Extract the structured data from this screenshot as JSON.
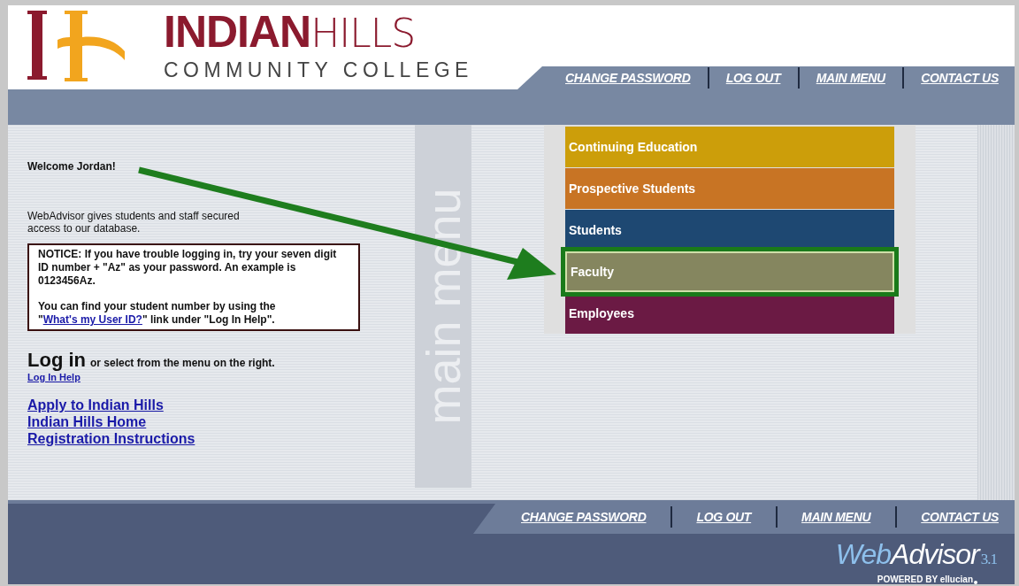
{
  "logo": {
    "name_bold": "INDIAN",
    "name_light": "HILLS",
    "subtitle": "COMMUNITY COLLEGE"
  },
  "top_nav": [
    "CHANGE PASSWORD",
    "LOG OUT",
    "MAIN MENU",
    "CONTACT US"
  ],
  "welcome": "Welcome Jordan!",
  "intro": "WebAdvisor gives students and staff secured access to our database.",
  "notice": {
    "text": "NOTICE: If you have trouble logging in, try your seven digit ID number + \"Az\" as your password. An example is 0123456Az.",
    "help_before": "You can find your student number by using the \"",
    "help_link": "What's my User ID?",
    "help_after": "\" link under \"Log In Help\"."
  },
  "login": {
    "heading": "Log in",
    "rest": "or select from the menu on the right.",
    "help_link": "Log In Help"
  },
  "links": [
    "Apply to Indian Hills",
    "Indian Hills Home",
    "Registration Instructions"
  ],
  "menu_watermark": "main menu",
  "menu": [
    {
      "label": "Continuing Education",
      "color": "#cc9e0a",
      "highlighted": false
    },
    {
      "label": "Prospective Students",
      "color": "#c87424",
      "highlighted": false
    },
    {
      "label": "Students",
      "color": "#1e4872",
      "highlighted": false
    },
    {
      "label": "Faculty",
      "color": "#85865f",
      "highlighted": true
    },
    {
      "label": "Employees",
      "color": "#6b1a44",
      "highlighted": false
    }
  ],
  "bottom_nav": [
    "CHANGE PASSWORD",
    "LOG OUT",
    "MAIN MENU",
    "CONTACT US"
  ],
  "footer_logo": {
    "web": "Web",
    "advisor": "Advisor",
    "version": "3.1",
    "powered": "POWERED BY ellucian"
  }
}
